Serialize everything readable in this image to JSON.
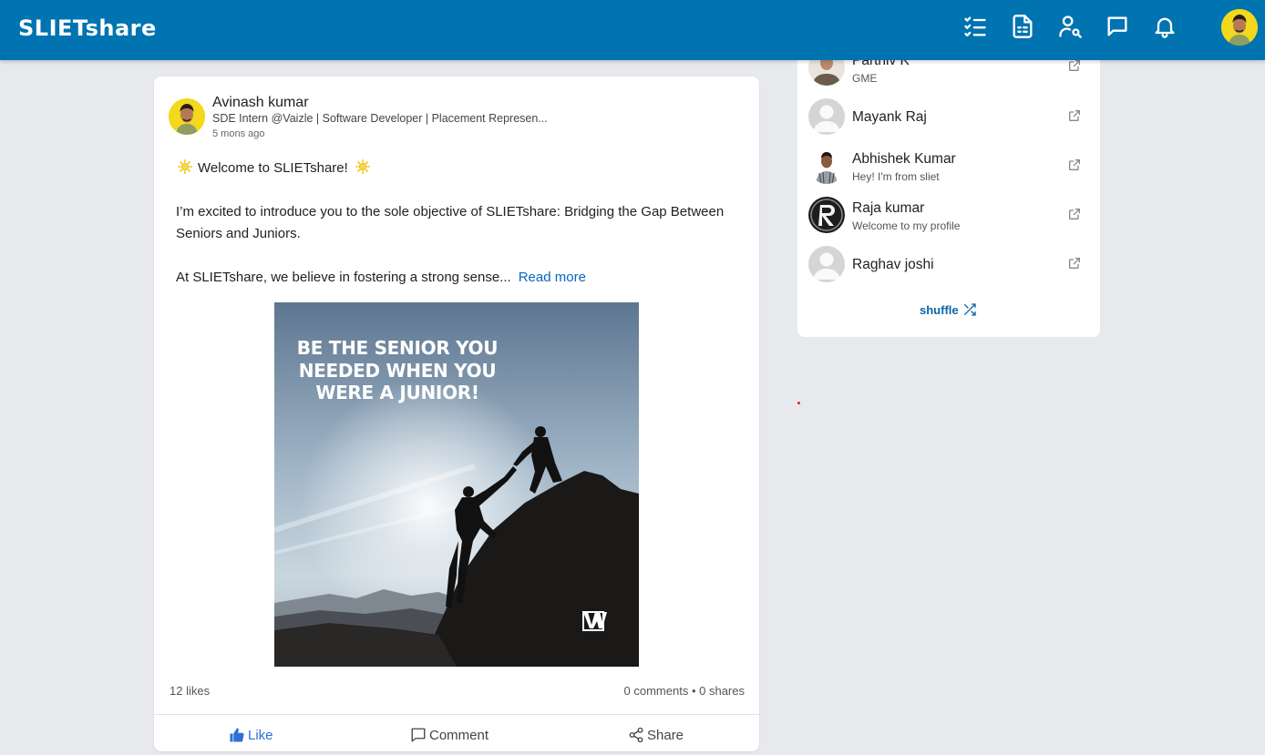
{
  "header": {
    "brand": "SLIETshare",
    "accent_color": "#0073b1",
    "icons": [
      "list-check-icon",
      "document-icon",
      "user-search-icon",
      "message-icon",
      "bell-icon"
    ]
  },
  "post": {
    "author_name": "Avinash kumar",
    "author_bio": "SDE Intern @Vaizle | Software Developer | Placement Represen...",
    "time_ago": "5 mons ago",
    "para1": "Welcome to SLIETshare!",
    "para2": "I’m excited to introduce you to the sole objective of SLIETshare: Bridging the Gap Between Seniors and Juniors.",
    "para3": "At SLIETshare, we believe in fostering a strong sense...",
    "read_more": "Read more",
    "image_caption": "BE THE SENIOR YOU NEEDED WHEN YOU WERE A JUNIOR!",
    "image_logo": "W",
    "likes": "12 likes",
    "comments": "0 comments",
    "shares": "0 shares",
    "like_label": "Like",
    "comment_label": "Comment",
    "share_label": "Share"
  },
  "sidebar": {
    "items": [
      {
        "name": "Parthiv K",
        "subtitle": "GME"
      },
      {
        "name": "Mayank Raj",
        "subtitle": ""
      },
      {
        "name": "Abhishek Kumar",
        "subtitle": "Hey! I'm from sliet"
      },
      {
        "name": "Raja kumar",
        "subtitle": "Welcome to my profile"
      },
      {
        "name": "Raghav joshi",
        "subtitle": ""
      }
    ],
    "shuffle_label": "shuffle"
  }
}
